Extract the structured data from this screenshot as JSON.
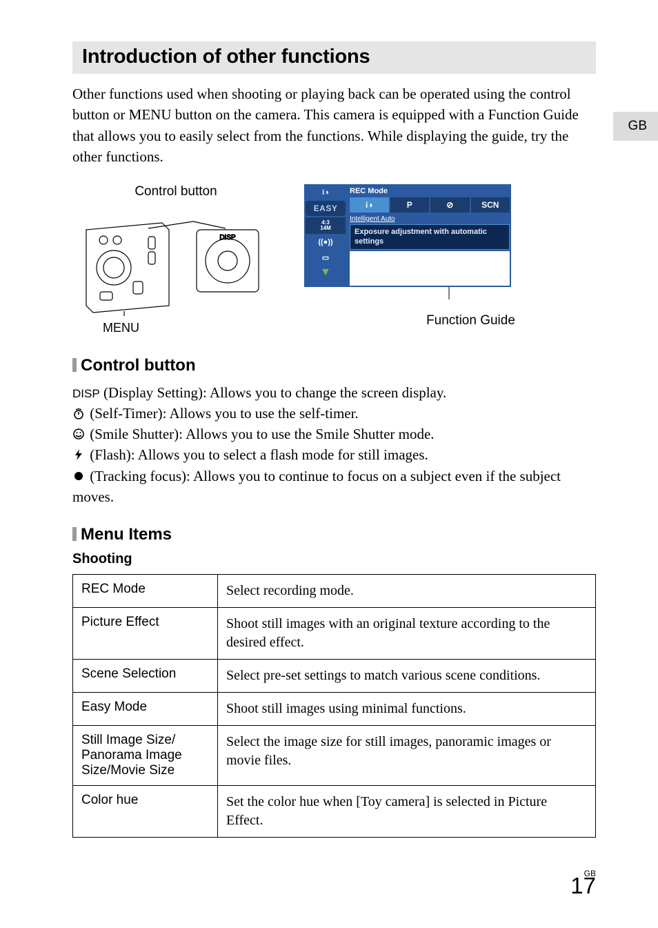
{
  "langTab": "GB",
  "title": "Introduction of other functions",
  "intro": "Other functions used when shooting or playing back can be operated using the control button or MENU button on the camera. This camera is equipped with a Function Guide that allows you to easily select from the functions. While displaying the guide, try the other functions.",
  "figLeft": {
    "controlButton": "Control button",
    "menu": "MENU"
  },
  "figRight": {
    "recMode": "REC Mode",
    "modes": {
      "p": "P",
      "scn": "SCN"
    },
    "easy": "EASY",
    "ratio": "4:3 14M",
    "intelligentAuto": "Intelligent Auto",
    "guide": "Exposure adjustment with automatic settings",
    "functionGuide": "Function Guide"
  },
  "controlButton": {
    "heading": "Control button",
    "disp": {
      "label": "DISP",
      "text": " (Display Setting): Allows you to change the screen display."
    },
    "timer": " (Self-Timer): Allows you to use the self-timer.",
    "smile": " (Smile Shutter): Allows you to use the Smile Shutter mode.",
    "flash": " (Flash): Allows you to select a flash mode for still images.",
    "track": " (Tracking focus): Allows you to continue to focus on a subject even if the subject moves."
  },
  "menuItems": {
    "heading": "Menu Items",
    "shooting": "Shooting",
    "rows": [
      {
        "name": "REC Mode",
        "desc": "Select recording mode."
      },
      {
        "name": "Picture Effect",
        "desc": "Shoot still images with an original texture according to the desired effect."
      },
      {
        "name": "Scene Selection",
        "desc": "Select pre-set settings to match various scene conditions."
      },
      {
        "name": "Easy Mode",
        "desc": "Shoot still images using minimal functions."
      },
      {
        "name": "Still Image Size/ Panorama Image Size/Movie Size",
        "desc": "Select the image size for still images, panoramic images or movie files."
      },
      {
        "name": "Color hue",
        "desc": "Set the color hue when [Toy camera] is selected in Picture Effect."
      }
    ]
  },
  "pageNum": {
    "gb": "GB",
    "num": "17"
  }
}
